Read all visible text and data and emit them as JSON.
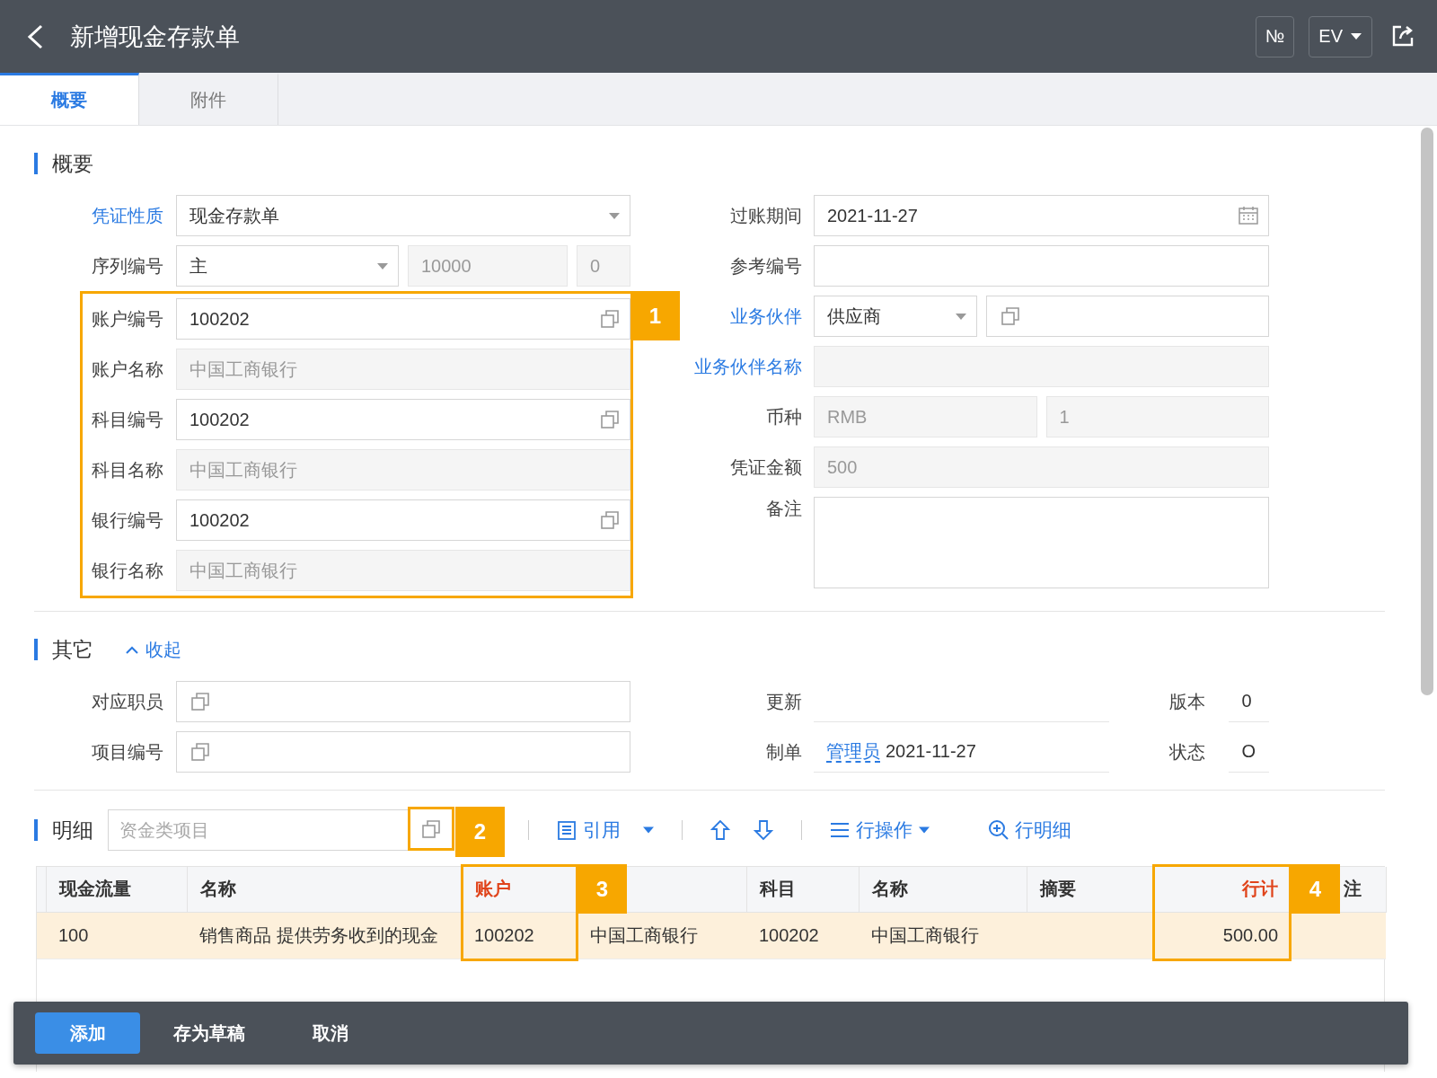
{
  "header": {
    "title": "新增现金存款单",
    "buttons": [
      {
        "kind": "number",
        "label": "№"
      },
      {
        "kind": "dropdown",
        "label": "EV"
      },
      {
        "kind": "share"
      }
    ]
  },
  "tabs": [
    {
      "label": "概要",
      "selected": true
    },
    {
      "label": "附件",
      "selected": false
    }
  ],
  "summary": {
    "title": "概要",
    "left": [
      {
        "label": "凭证性质",
        "link": true,
        "parts": [
          {
            "kind": "select",
            "value": "现金存款单"
          }
        ]
      },
      {
        "label": "序列编号",
        "link": false,
        "parts": [
          {
            "kind": "select",
            "value": "主"
          },
          {
            "kind": "readonly",
            "value": "10000"
          },
          {
            "kind": "readonly",
            "value": "0"
          }
        ]
      },
      {
        "kind": "group",
        "callout": "1",
        "rows": [
          {
            "label": "账户编号",
            "link": false,
            "parts": [
              {
                "kind": "lookup",
                "value": "100202"
              }
            ]
          },
          {
            "label": "账户名称",
            "link": false,
            "parts": [
              {
                "kind": "readonly",
                "value": "中国工商银行"
              }
            ]
          },
          {
            "label": "科目编号",
            "link": false,
            "parts": [
              {
                "kind": "lookup",
                "value": "100202"
              }
            ]
          },
          {
            "label": "科目名称",
            "link": false,
            "parts": [
              {
                "kind": "readonly",
                "value": "中国工商银行"
              }
            ]
          },
          {
            "label": "银行编号",
            "link": false,
            "parts": [
              {
                "kind": "lookup",
                "value": "100202"
              }
            ]
          },
          {
            "label": "银行名称",
            "link": false,
            "parts": [
              {
                "kind": "readonly",
                "value": "中国工商银行"
              }
            ]
          }
        ]
      }
    ],
    "right": [
      {
        "label": "过账期间",
        "link": false,
        "parts": [
          {
            "kind": "date",
            "value": "2021-11-27"
          }
        ]
      },
      {
        "label": "参考编号",
        "link": false,
        "parts": [
          {
            "kind": "input"
          }
        ]
      },
      {
        "label": "业务伙伴",
        "link": true,
        "parts": [
          {
            "kind": "select",
            "value": "供应商"
          },
          {
            "kind": "lookup"
          }
        ]
      },
      {
        "label": "业务伙伴名称",
        "link": true,
        "parts": [
          {
            "kind": "readonly"
          }
        ]
      },
      {
        "label": "币种",
        "link": false,
        "parts": [
          {
            "kind": "readonly",
            "value": "RMB"
          },
          {
            "kind": "readonly",
            "value": "1"
          }
        ]
      },
      {
        "label": "凭证金额",
        "link": false,
        "parts": [
          {
            "kind": "readonly",
            "value": "500"
          }
        ]
      },
      {
        "label": "备注",
        "link": false,
        "parts": [
          {
            "kind": "textarea"
          }
        ]
      }
    ]
  },
  "other": {
    "title": "其它",
    "toggle": "收起",
    "expanded": true,
    "left": [
      {
        "label": "对应职员",
        "link": false,
        "parts": [
          {
            "kind": "lookup"
          }
        ]
      },
      {
        "label": "项目编号",
        "link": false,
        "parts": [
          {
            "kind": "lookup"
          }
        ]
      }
    ],
    "right": [
      {
        "label": "更新",
        "extra_label": "版本",
        "extra_value": "0"
      },
      {
        "label": "制单",
        "user": "管理员",
        "value": "2021-11-27",
        "extra_label": "状态",
        "extra_value": "O"
      }
    ]
  },
  "detail": {
    "title": "明细",
    "search": {
      "placeholder": "资金类项目",
      "callout": "2"
    },
    "tools": [
      {
        "kind": "sep"
      },
      {
        "kind": "list",
        "label": "引用"
      },
      {
        "kind": "caret"
      },
      {
        "kind": "sep"
      },
      {
        "kind": "up"
      },
      {
        "kind": "down"
      },
      {
        "kind": "sep"
      },
      {
        "kind": "menu",
        "label": "行操作"
      },
      {
        "kind": "zoom",
        "label": "行明细"
      }
    ],
    "columns": [
      {
        "kind": "lead"
      },
      {
        "label": "现金流量",
        "required": false
      },
      {
        "label": "名称",
        "required": false
      },
      {
        "label": "账户",
        "required": true,
        "callout": "3"
      },
      {
        "kind": "text"
      },
      {
        "label": "科目",
        "required": false
      },
      {
        "label": "名称",
        "required": false
      },
      {
        "label": "摘要",
        "required": false
      },
      {
        "label": "行计",
        "required": true,
        "kind": "amount",
        "callout": "4"
      },
      {
        "label": "注",
        "required": false,
        "kind": "tail"
      }
    ],
    "rows": [
      {
        "selected": true,
        "cells": [
          null,
          "100",
          "销售商品 提供劳务收到的现金",
          "100202",
          "中国工商银行",
          "100202",
          "中国工商银行",
          null,
          "500.00",
          null
        ]
      }
    ]
  },
  "footer": {
    "buttons": [
      {
        "label": "添加",
        "primary": true
      },
      {
        "label": "存为草稿",
        "primary": false
      },
      {
        "label": "取消",
        "primary": false
      }
    ]
  }
}
